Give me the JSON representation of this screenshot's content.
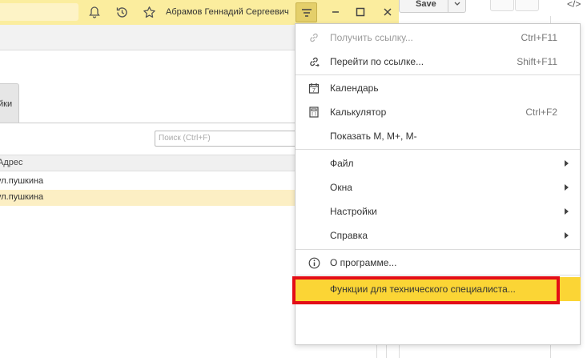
{
  "header": {
    "user_name": "Абрамов Геннадий Сергеевич",
    "icons": [
      "bell-icon",
      "history-icon",
      "star-icon"
    ],
    "menu_icon": "menu-icon",
    "window_controls": [
      "minimize-icon",
      "maximize-icon",
      "close-icon"
    ]
  },
  "right_toolbar": {
    "save_label": "Save",
    "code_label": "</>"
  },
  "form": {
    "tab_label": "йки",
    "search_placeholder": "Поиск (Ctrl+F)",
    "column_header": "Адрес",
    "rows": [
      {
        "address": "ул.пушкина",
        "selected": false
      },
      {
        "address": "ул.пушкина",
        "selected": true
      }
    ]
  },
  "menu": {
    "items": [
      {
        "label": "Получить ссылку...",
        "shortcut": "Ctrl+F11",
        "icon": "link-icon",
        "disabled": true
      },
      {
        "label": "Перейти по ссылке...",
        "shortcut": "Shift+F11",
        "icon": "link-go-icon",
        "disabled": false
      },
      {
        "label": "Календарь",
        "shortcut": "",
        "icon": "calendar-icon",
        "disabled": false
      },
      {
        "label": "Калькулятор",
        "shortcut": "Ctrl+F2",
        "icon": "calculator-icon",
        "disabled": false
      },
      {
        "label": "Показать М, М+, М-",
        "shortcut": "",
        "icon": "",
        "disabled": false
      },
      {
        "label": "Файл",
        "submenu": true
      },
      {
        "label": "Окна",
        "submenu": true
      },
      {
        "label": "Настройки",
        "submenu": true
      },
      {
        "label": "Справка",
        "submenu": true
      },
      {
        "label": "О программе...",
        "icon": "info-icon"
      },
      {
        "label": "Функции для технического специалиста...",
        "highlighted": true
      }
    ]
  },
  "colors": {
    "titlebar": "#fbed9e",
    "highlight": "#fbd535",
    "annotation_border": "#e30d16",
    "selected_row": "#fcefc4"
  }
}
